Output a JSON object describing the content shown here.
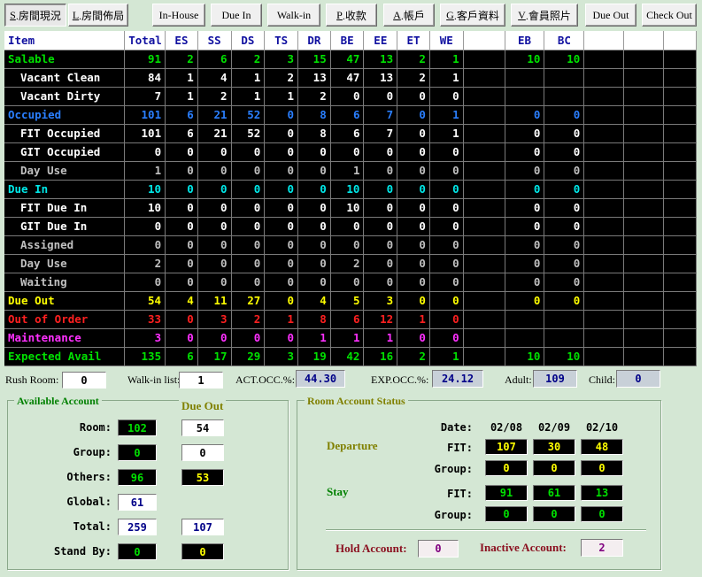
{
  "toolbar": [
    {
      "mn": "S",
      "label": ".房間現況",
      "active": true
    },
    {
      "mn": "L",
      "label": ".房間佈局",
      "active": false
    },
    {
      "mn": "",
      "label": "In-House",
      "active": false
    },
    {
      "mn": "",
      "label": "Due In",
      "active": false
    },
    {
      "mn": "",
      "label": "Walk-in",
      "active": false
    },
    {
      "mn": "P",
      "label": ".收款",
      "active": false
    },
    {
      "mn": "A",
      "label": ".帳戶",
      "active": false
    },
    {
      "mn": "G",
      "label": ".客戶資料",
      "active": false
    },
    {
      "mn": "V",
      "label": ".會員照片",
      "active": false
    },
    {
      "mn": "",
      "label": "Due Out",
      "active": false
    },
    {
      "mn": "",
      "label": "Check Out",
      "active": false
    }
  ],
  "colors": {
    "green": "#00e000",
    "white": "#ffffff",
    "blue": "#2a7fff",
    "cyan": "#00e8e8",
    "gray": "#c0c0c0",
    "yellow": "#ffff00",
    "red": "#ff2020",
    "magenta": "#ff30ff"
  },
  "grid": {
    "headers": [
      "Item",
      "Total",
      "ES",
      "SS",
      "DS",
      "TS",
      "DR",
      "BE",
      "EE",
      "ET",
      "WE",
      "",
      "EB",
      "BC",
      "",
      "",
      ""
    ],
    "rows": [
      {
        "label": "Salable",
        "color": "green",
        "indent": false,
        "values": [
          "91",
          "2",
          "6",
          "2",
          "3",
          "15",
          "47",
          "13",
          "2",
          "1",
          "",
          "10",
          "10",
          "",
          "",
          ""
        ]
      },
      {
        "label": "Vacant Clean",
        "color": "white",
        "indent": true,
        "values": [
          "84",
          "1",
          "4",
          "1",
          "2",
          "13",
          "47",
          "13",
          "2",
          "1",
          "",
          "",
          "",
          "",
          "",
          ""
        ]
      },
      {
        "label": "Vacant Dirty",
        "color": "white",
        "indent": true,
        "values": [
          "7",
          "1",
          "2",
          "1",
          "1",
          "2",
          "0",
          "0",
          "0",
          "0",
          "",
          "",
          "",
          "",
          "",
          ""
        ]
      },
      {
        "label": "Occupied",
        "color": "blue",
        "indent": false,
        "values": [
          "101",
          "6",
          "21",
          "52",
          "0",
          "8",
          "6",
          "7",
          "0",
          "1",
          "",
          "0",
          "0",
          "",
          "",
          ""
        ]
      },
      {
        "label": "FIT Occupied",
        "color": "white",
        "indent": true,
        "values": [
          "101",
          "6",
          "21",
          "52",
          "0",
          "8",
          "6",
          "7",
          "0",
          "1",
          "",
          "0",
          "0",
          "",
          "",
          ""
        ]
      },
      {
        "label": "GIT Occupied",
        "color": "white",
        "indent": true,
        "values": [
          "0",
          "0",
          "0",
          "0",
          "0",
          "0",
          "0",
          "0",
          "0",
          "0",
          "",
          "0",
          "0",
          "",
          "",
          ""
        ]
      },
      {
        "label": "Day Use",
        "color": "gray",
        "indent": true,
        "values": [
          "1",
          "0",
          "0",
          "0",
          "0",
          "0",
          "1",
          "0",
          "0",
          "0",
          "",
          "0",
          "0",
          "",
          "",
          ""
        ]
      },
      {
        "label": "Due In",
        "color": "cyan",
        "indent": false,
        "values": [
          "10",
          "0",
          "0",
          "0",
          "0",
          "0",
          "10",
          "0",
          "0",
          "0",
          "",
          "0",
          "0",
          "",
          "",
          ""
        ]
      },
      {
        "label": "FIT Due In",
        "color": "white",
        "indent": true,
        "values": [
          "10",
          "0",
          "0",
          "0",
          "0",
          "0",
          "10",
          "0",
          "0",
          "0",
          "",
          "0",
          "0",
          "",
          "",
          ""
        ]
      },
      {
        "label": "GIT Due In",
        "color": "white",
        "indent": true,
        "values": [
          "0",
          "0",
          "0",
          "0",
          "0",
          "0",
          "0",
          "0",
          "0",
          "0",
          "",
          "0",
          "0",
          "",
          "",
          ""
        ]
      },
      {
        "label": "Assigned",
        "color": "gray",
        "indent": true,
        "values": [
          "0",
          "0",
          "0",
          "0",
          "0",
          "0",
          "0",
          "0",
          "0",
          "0",
          "",
          "0",
          "0",
          "",
          "",
          ""
        ]
      },
      {
        "label": "Day Use",
        "color": "gray",
        "indent": true,
        "values": [
          "2",
          "0",
          "0",
          "0",
          "0",
          "0",
          "2",
          "0",
          "0",
          "0",
          "",
          "0",
          "0",
          "",
          "",
          ""
        ]
      },
      {
        "label": "Waiting",
        "color": "gray",
        "indent": true,
        "values": [
          "0",
          "0",
          "0",
          "0",
          "0",
          "0",
          "0",
          "0",
          "0",
          "0",
          "",
          "0",
          "0",
          "",
          "",
          ""
        ]
      },
      {
        "label": "Due Out",
        "color": "yellow",
        "indent": false,
        "values": [
          "54",
          "4",
          "11",
          "27",
          "0",
          "4",
          "5",
          "3",
          "0",
          "0",
          "",
          "0",
          "0",
          "",
          "",
          ""
        ]
      },
      {
        "label": "Out of Order",
        "color": "red",
        "indent": false,
        "values": [
          "33",
          "0",
          "3",
          "2",
          "1",
          "8",
          "6",
          "12",
          "1",
          "0",
          "",
          "",
          "",
          "",
          "",
          ""
        ]
      },
      {
        "label": "Maintenance",
        "color": "magenta",
        "indent": false,
        "values": [
          "3",
          "0",
          "0",
          "0",
          "0",
          "1",
          "1",
          "1",
          "0",
          "0",
          "",
          "",
          "",
          "",
          "",
          ""
        ]
      },
      {
        "label": "Expected Avail",
        "color": "green",
        "indent": false,
        "values": [
          "135",
          "6",
          "17",
          "29",
          "3",
          "19",
          "42",
          "16",
          "2",
          "1",
          "",
          "10",
          "10",
          "",
          "",
          ""
        ]
      }
    ]
  },
  "status": {
    "rush_room_label": "Rush Room:",
    "rush_room": "0",
    "walkin_label": "Walk-in list:",
    "walkin": "1",
    "act_occ_label": "ACT.OCC.%:",
    "act_occ": "44.30",
    "exp_occ_label": "EXP.OCC.%:",
    "exp_occ": "24.12",
    "adult_label": "Adult:",
    "adult": "109",
    "child_label": "Child:",
    "child": "0"
  },
  "available": {
    "title": "Available Account",
    "due_out_title": "Due Out",
    "room_label": "Room:",
    "room": "102",
    "room_due": "54",
    "group_label": "Group:",
    "group": "0",
    "group_due": "0",
    "others_label": "Others:",
    "others": "96",
    "others_due": "53",
    "global_label": "Global:",
    "global": "61",
    "total_label": "Total:",
    "total": "259",
    "total_due": "107",
    "standby_label": "Stand By:",
    "standby": "0",
    "standby_due": "0"
  },
  "room_account": {
    "title": "Room Account Status",
    "date_label": "Date:",
    "dates": [
      "02/08",
      "02/09",
      "02/10"
    ],
    "departure_label": "Departure",
    "stay_label": "Stay",
    "fit_label": "FIT:",
    "group_label": "Group:",
    "departure_fit": [
      "107",
      "30",
      "48"
    ],
    "departure_group": [
      "0",
      "0",
      "0"
    ],
    "stay_fit": [
      "91",
      "61",
      "13"
    ],
    "stay_group": [
      "0",
      "0",
      "0"
    ],
    "hold_label": "Hold Account:",
    "hold": "0",
    "inactive_label": "Inactive Account:",
    "inactive": "2"
  }
}
